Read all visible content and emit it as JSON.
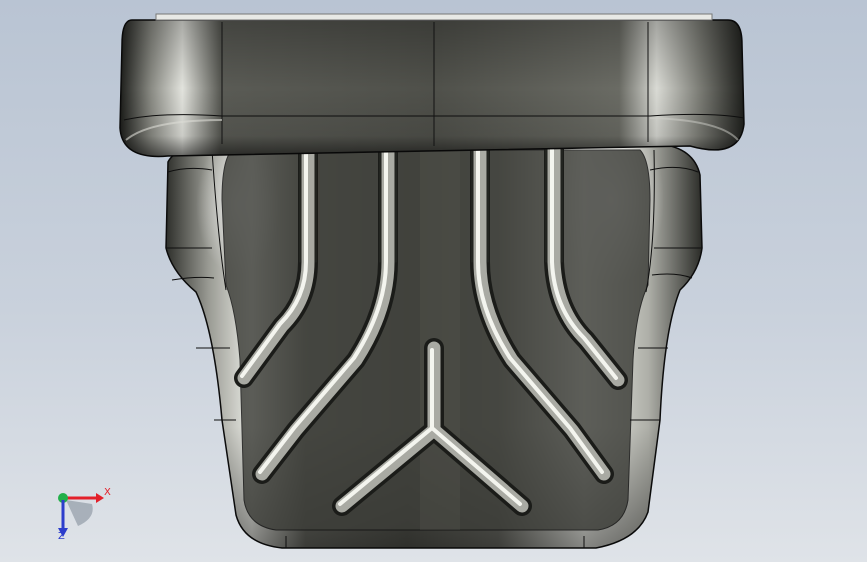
{
  "viewport": {
    "background_top": "#b9c4d3",
    "background_bottom": "#dfe3e8"
  },
  "model": {
    "body_color": "#4a4b44",
    "highlight_color": "#f4f5ef",
    "edge_color": "#111111"
  },
  "triad": {
    "x_label": "X",
    "z_label": "Z",
    "x_color": "#e3202a",
    "y_color": "#22b04a",
    "z_color": "#2c3dcc"
  }
}
